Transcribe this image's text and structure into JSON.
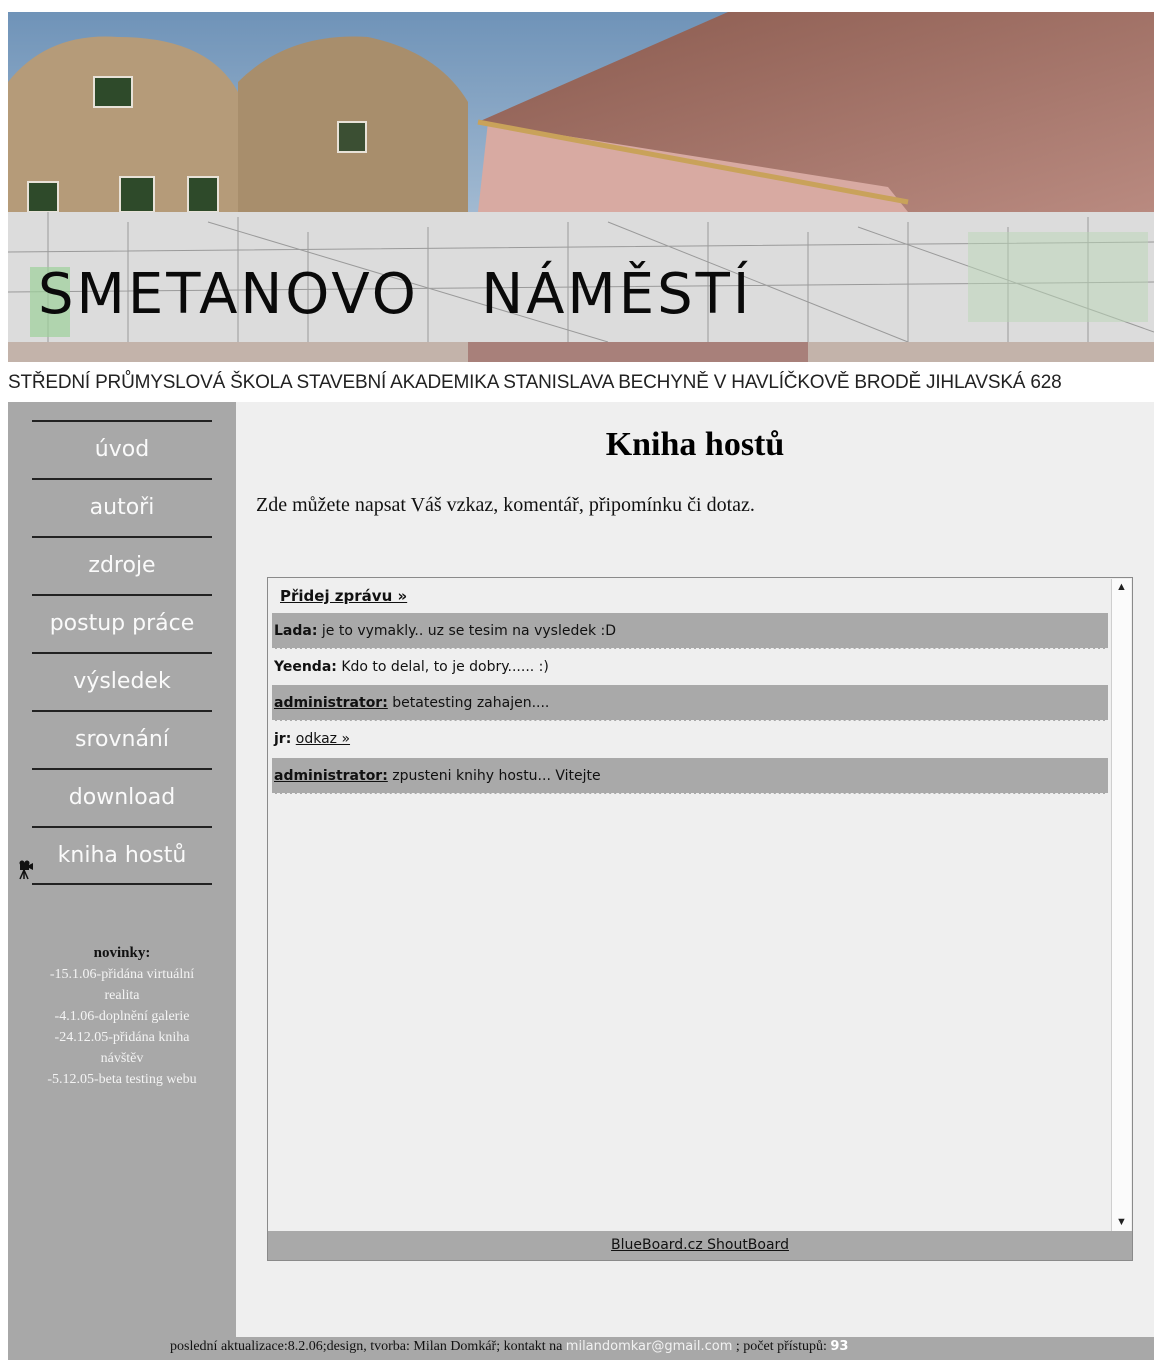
{
  "banner": {
    "title": "SMETANOVO   NÁMĚSTÍ"
  },
  "school_line": "STŘEDNÍ PRŮMYSLOVÁ ŠKOLA STAVEBNÍ AKADEMIKA STANISLAVA BECHYNĚ V HAVLÍČKOVĚ BRODĚ JIHLAVSKÁ 628",
  "nav": {
    "items": [
      {
        "label": "úvod"
      },
      {
        "label": "autoři"
      },
      {
        "label": "zdroje"
      },
      {
        "label": "postup práce"
      },
      {
        "label": "výsledek"
      },
      {
        "label": "srovnání"
      },
      {
        "label": "download"
      },
      {
        "label": "kniha hostů",
        "icon": "camera-icon",
        "active": true
      }
    ]
  },
  "news": {
    "title": "novinky:",
    "items": [
      "-15.1.06-přidána virtuální",
      "realita",
      "-4.1.06-doplnění galerie",
      "-24.12.05-přidána kniha",
      "návštěv",
      "-5.12.05-beta testing webu"
    ]
  },
  "content": {
    "title": "Kniha hostů",
    "intro": "Zde můžete napsat Váš vzkaz, komentář, připomínku či dotaz."
  },
  "shoutbox": {
    "add_label": "Přidej zprávu »",
    "messages": [
      {
        "author": "Lada:",
        "text": " je to vymakly.. uz se tesim na vysledek :D"
      },
      {
        "author": "Yeenda:",
        "text": " Kdo to delal, to je dobry...... :)"
      },
      {
        "author": "administrator:",
        "text": " betatesting zahajen...."
      },
      {
        "author": "jr:",
        "link": "odkaz »"
      },
      {
        "author": "administrator:",
        "text": " zpusteni knihy hostu... Vitejte"
      }
    ],
    "footer_link": "BlueBoard.cz ShoutBoard"
  },
  "footer": {
    "prefix": "poslední aktualizace:8.2.06;design, tvorba: Milan Domkář; kontakt na ",
    "email": "milandomkar@gmail.com",
    "count_label": " ; počet přístupů: ",
    "count": "93"
  }
}
